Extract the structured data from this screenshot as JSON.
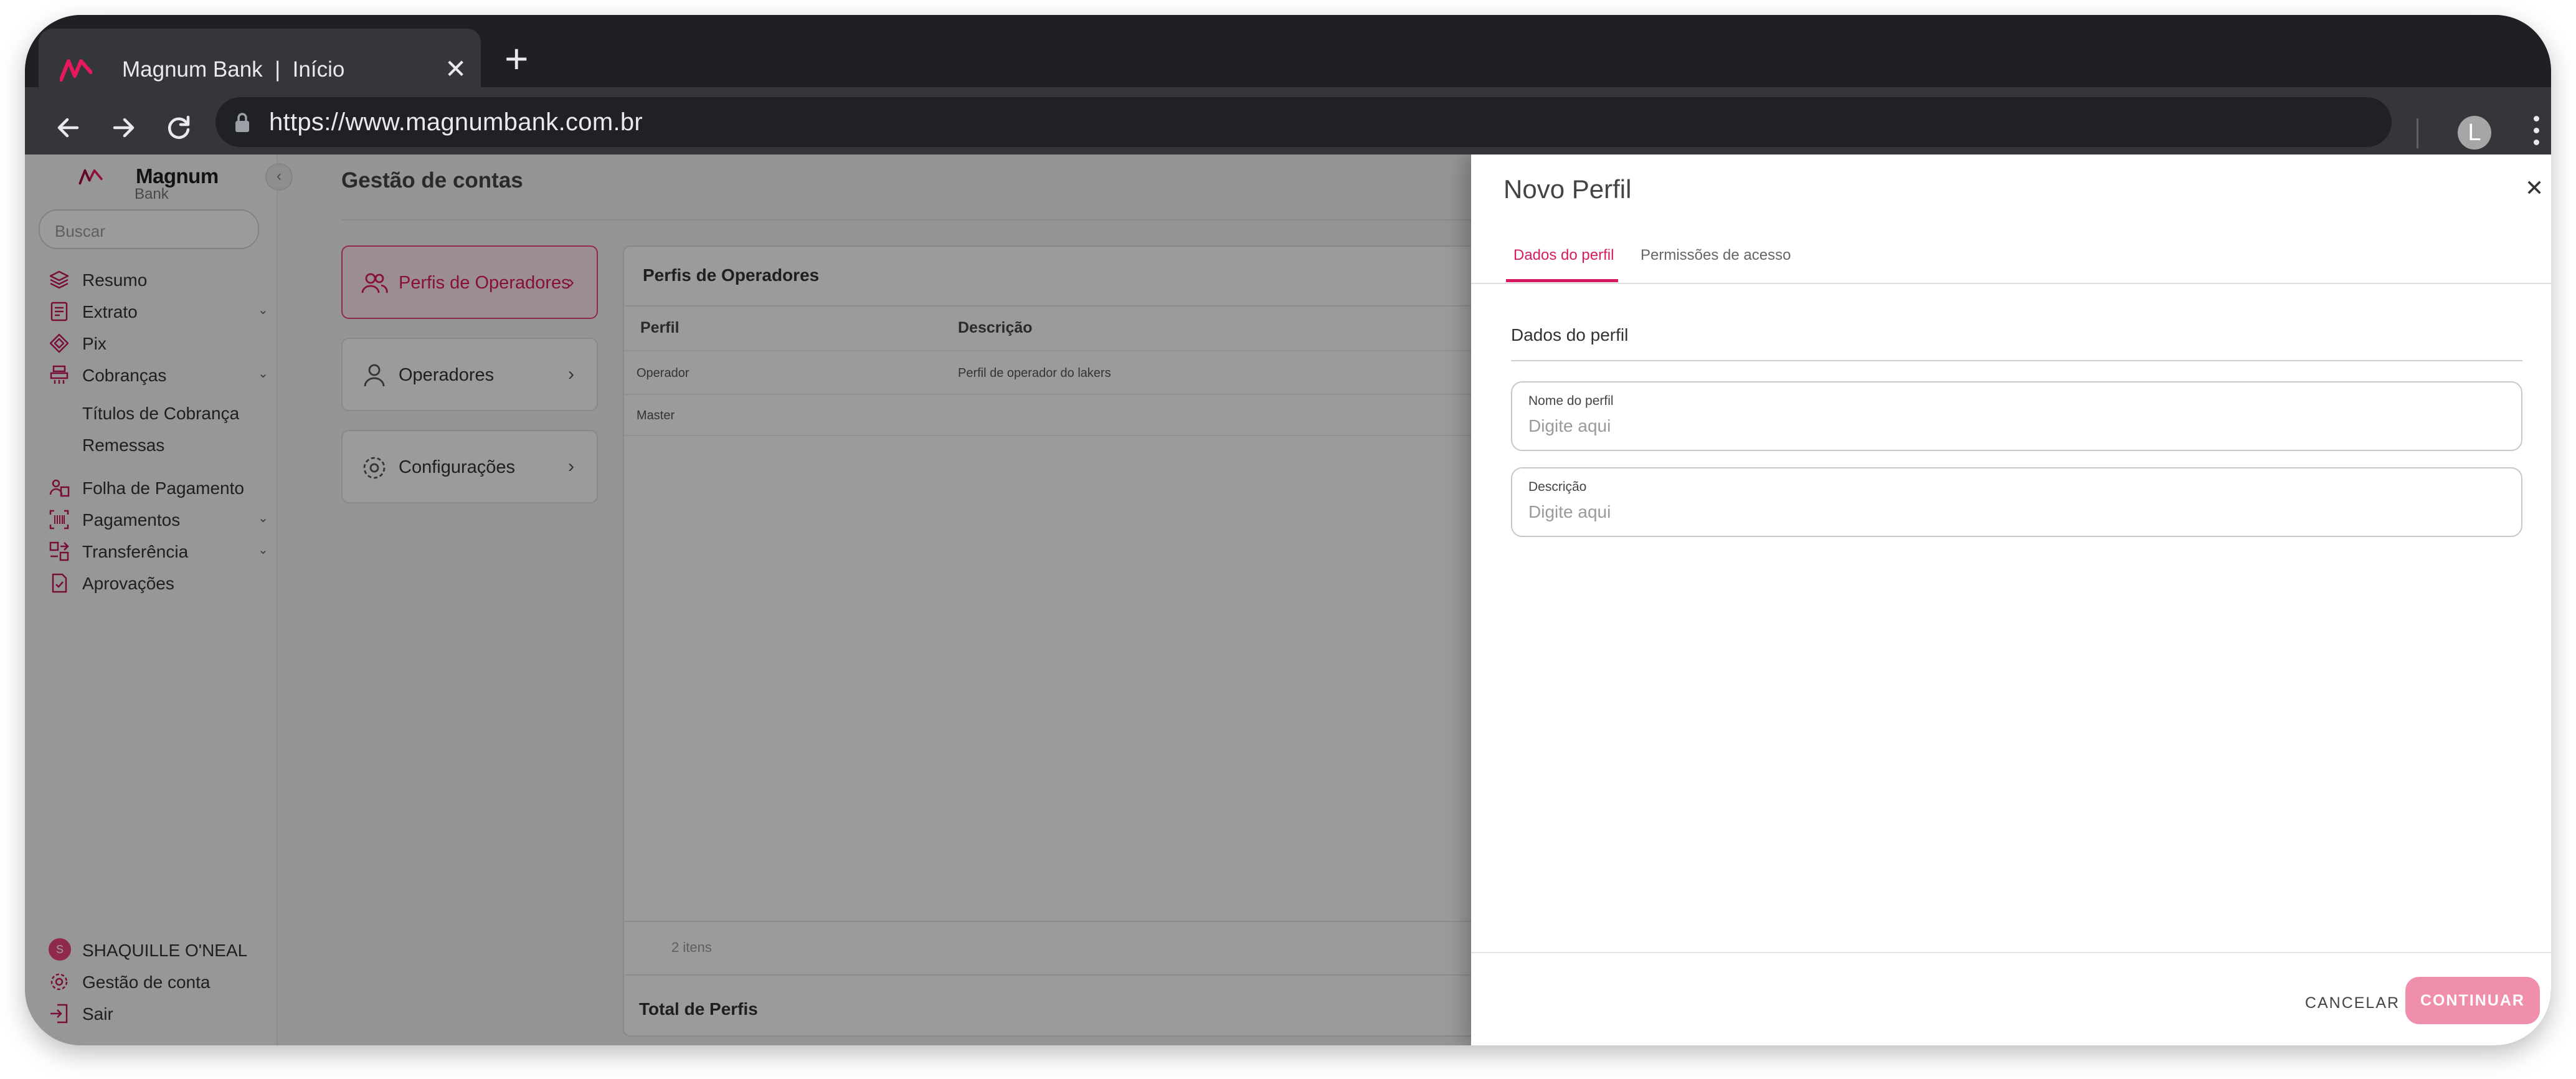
{
  "browser": {
    "tab_title": "Magnum Bank  |  Início",
    "url": "https://www.magnumbank.com.br",
    "profile_initial": "L"
  },
  "brand": {
    "name": "Magnum",
    "sub": "Bank",
    "accent_color": "#d81b60"
  },
  "sidebar": {
    "search_placeholder": "Buscar",
    "items": [
      {
        "label": "Resumo",
        "icon": "layers-icon"
      },
      {
        "label": "Extrato",
        "icon": "statement-icon",
        "expandable": true
      },
      {
        "label": "Pix",
        "icon": "pix-icon"
      },
      {
        "label": "Cobranças",
        "icon": "billing-icon",
        "expandable": true
      }
    ],
    "subitems": [
      "Títulos de Cobrança",
      "Remessas"
    ],
    "items2": [
      {
        "label": "Folha de Pagamento",
        "icon": "payroll-icon"
      },
      {
        "label": "Pagamentos",
        "icon": "barcode-icon",
        "expandable": true
      },
      {
        "label": "Transferência",
        "icon": "transfer-icon",
        "expandable": true
      },
      {
        "label": "Aprovações",
        "icon": "approval-icon"
      }
    ],
    "user": {
      "initial": "S",
      "name": "SHAQUILLE O'NEAL"
    },
    "account_label": "Gestão de conta",
    "logout_label": "Sair"
  },
  "main": {
    "page_title": "Gestão de contas",
    "nav_cards": [
      {
        "label": "Perfis de Operadores",
        "active": true
      },
      {
        "label": "Operadores",
        "active": false
      },
      {
        "label": "Configurações",
        "active": false
      }
    ],
    "table": {
      "title": "Perfis de Operadores",
      "columns": [
        "Perfil",
        "Descrição"
      ],
      "rows": [
        [
          "Operador",
          "Perfil de operador do lakers"
        ],
        [
          "Master",
          ""
        ]
      ],
      "count": "2 itens",
      "total_label": "Total de Perfis"
    }
  },
  "drawer": {
    "title": "Novo Perfil",
    "tabs": [
      "Dados do perfil",
      "Permissões de acesso"
    ],
    "active_tab": 0,
    "section_title": "Dados do perfil",
    "fields": [
      {
        "label": "Nome do perfil",
        "placeholder": "Digite aqui",
        "value": ""
      },
      {
        "label": "Descrição",
        "placeholder": "Digite aqui",
        "value": ""
      }
    ],
    "cancel_label": "CANCELAR",
    "continue_label": "CONTINUAR"
  }
}
